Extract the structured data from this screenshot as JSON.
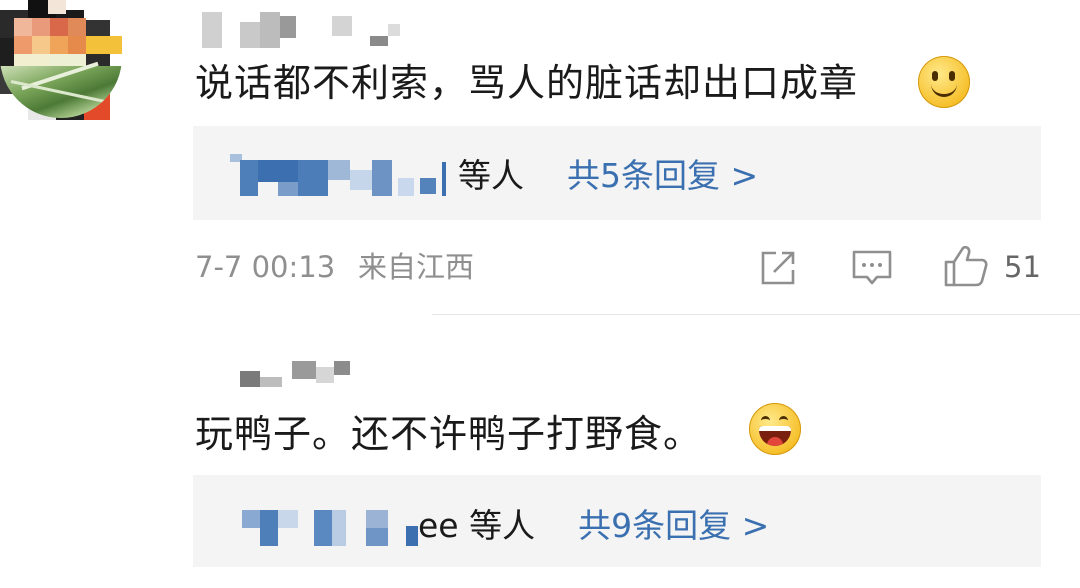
{
  "comments": [
    {
      "text": "说话都不利索，骂人的脏话却出口成章",
      "emoji": "smile-emoji",
      "reply_tail": "等人",
      "reply_count": "共5条回复 >",
      "time": "7-7 00:13",
      "location": "来自江西",
      "likes": "51"
    },
    {
      "text": "玩鸭子。还不许鸭子打野食。",
      "emoji": "laugh-emoji",
      "reply_tail": "ee 等人",
      "reply_count": "共9条回复 >"
    }
  ],
  "colors": {
    "link_blue": "#3a6fb0",
    "reply_bg": "#f4f4f4",
    "meta_gray": "#8f8f8f"
  },
  "icons": [
    "share-icon",
    "comment-icon",
    "like-icon"
  ]
}
